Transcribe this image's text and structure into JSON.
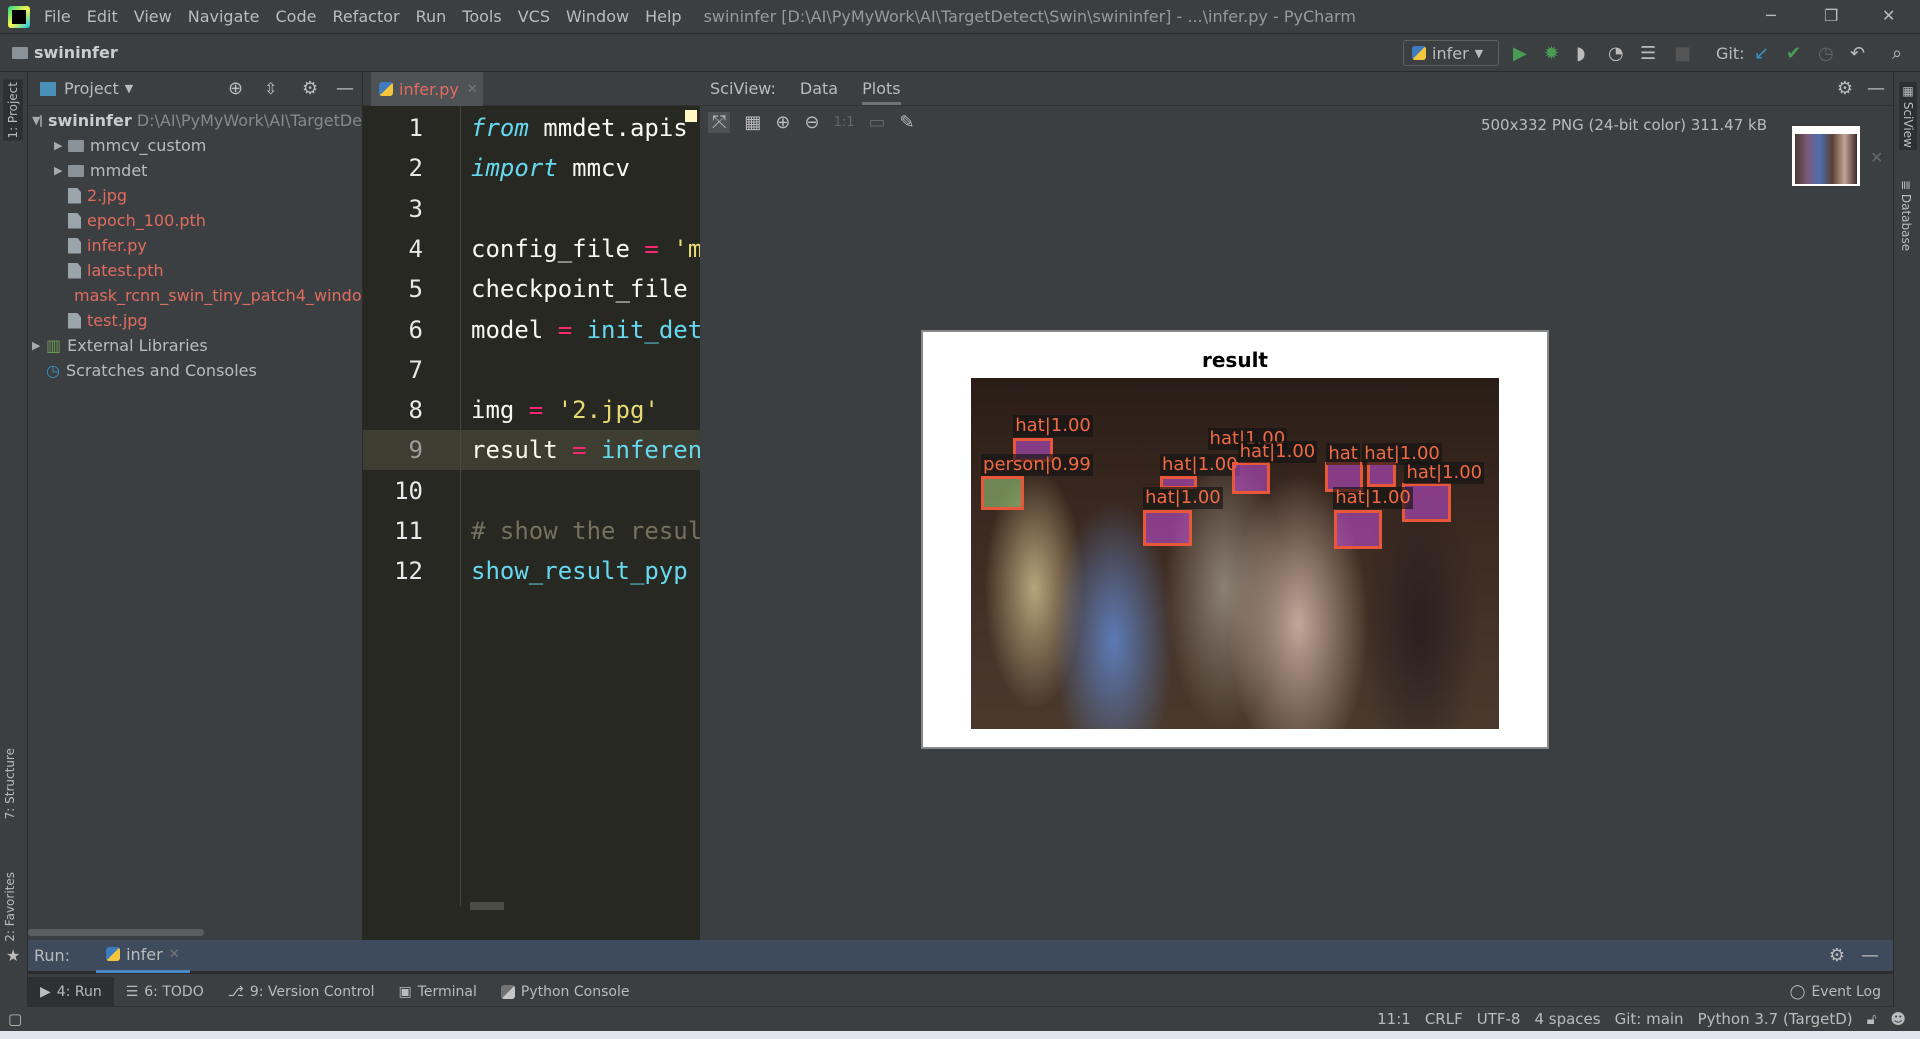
{
  "window": {
    "title": "swininfer [D:\\AI\\PyMyWork\\AI\\TargetDetect\\Swin\\swininfer] - ...\\infer.py - PyCharm",
    "minimize": "─",
    "restore": "❐",
    "close": "✕"
  },
  "menu": [
    "File",
    "Edit",
    "View",
    "Navigate",
    "Code",
    "Refactor",
    "Run",
    "Tools",
    "VCS",
    "Window",
    "Help"
  ],
  "navbar": {
    "breadcrumb": "swininfer",
    "run_config": "infer",
    "git_label": "Git:"
  },
  "left_stripe": {
    "project": "1: Project",
    "structure": "7: Structure",
    "favorites": "2: Favorites"
  },
  "right_stripe": {
    "sciview": "SciView",
    "database": "Database"
  },
  "project": {
    "header": "Project",
    "root": {
      "name": "swininfer",
      "path": "D:\\AI\\PyMyWork\\AI\\TargetDe"
    },
    "items": [
      {
        "name": "mmcv_custom",
        "type": "folder"
      },
      {
        "name": "mmdet",
        "type": "folder"
      },
      {
        "name": "2.jpg",
        "type": "file"
      },
      {
        "name": "epoch_100.pth",
        "type": "file"
      },
      {
        "name": "infer.py",
        "type": "file"
      },
      {
        "name": "latest.pth",
        "type": "file"
      },
      {
        "name": "mask_rcnn_swin_tiny_patch4_windov",
        "type": "file"
      },
      {
        "name": "test.jpg",
        "type": "file"
      }
    ],
    "external": "External Libraries",
    "scratches": "Scratches and Consoles"
  },
  "editor": {
    "tab": "infer.py",
    "current_line": 9,
    "lines": [
      {
        "n": "1",
        "tokens": [
          [
            "from",
            "kw"
          ],
          [
            " mmdet.apis",
            "id"
          ]
        ]
      },
      {
        "n": "2",
        "tokens": [
          [
            "import",
            "kw"
          ],
          [
            " mmcv",
            "id"
          ]
        ]
      },
      {
        "n": "3",
        "tokens": []
      },
      {
        "n": "4",
        "tokens": [
          [
            "config_file ",
            "id"
          ],
          [
            "=",
            "op"
          ],
          [
            " 'm",
            "str"
          ]
        ]
      },
      {
        "n": "5",
        "tokens": [
          [
            "checkpoint_file",
            "id"
          ]
        ]
      },
      {
        "n": "6",
        "tokens": [
          [
            "model ",
            "id"
          ],
          [
            "=",
            "op"
          ],
          [
            " init_det",
            "fn"
          ]
        ]
      },
      {
        "n": "7",
        "tokens": []
      },
      {
        "n": "8",
        "tokens": [
          [
            "img ",
            "id"
          ],
          [
            "=",
            "op"
          ],
          [
            " '2.jpg'",
            "str"
          ]
        ]
      },
      {
        "n": "9",
        "tokens": [
          [
            "result ",
            "id"
          ],
          [
            "=",
            "op"
          ],
          [
            " inferen",
            "fn"
          ]
        ]
      },
      {
        "n": "10",
        "tokens": []
      },
      {
        "n": "11",
        "tokens": [
          [
            "# show the resul",
            "cm"
          ]
        ]
      },
      {
        "n": "12",
        "tokens": [
          [
            "show_result_pyp",
            "fn"
          ]
        ]
      }
    ]
  },
  "sciview": {
    "label": "SciView:",
    "tabs": [
      "Data",
      "Plots"
    ],
    "active_tab": "Plots",
    "image_info": "500x332 PNG (24-bit color) 311.47 kB",
    "figure": {
      "title": "result",
      "detections": [
        {
          "label": "hat|1.00",
          "class": "hat"
        },
        {
          "label": "person|0.99",
          "class": "person"
        },
        {
          "label": "hat|1.00",
          "class": "hat"
        },
        {
          "label": "hat|1.00",
          "class": "hat"
        },
        {
          "label": "hat|1.00",
          "class": "hat"
        },
        {
          "label": "hat|1.00",
          "class": "hat"
        },
        {
          "label": "hat",
          "class": "hat"
        },
        {
          "label": "hat|1.00",
          "class": "hat"
        },
        {
          "label": "hat|1.00",
          "class": "hat"
        },
        {
          "label": "hat|1.00",
          "class": "hat"
        }
      ]
    }
  },
  "run": {
    "label": "Run:",
    "tab": "infer"
  },
  "tool_windows": [
    "4: Run",
    "6: TODO",
    "9: Version Control",
    "Terminal",
    "Python Console"
  ],
  "event_log": "Event Log",
  "status": {
    "position": "11:1",
    "line_sep": "CRLF",
    "encoding": "UTF-8",
    "indent": "4 spaces",
    "git": "Git: main",
    "interpreter": "Python 3.7 (TargetD)"
  },
  "colors": {
    "accent": "#4a88c7",
    "run_green": "#499c54",
    "file_modified": "#e06c5f",
    "box": "#e8573a"
  }
}
